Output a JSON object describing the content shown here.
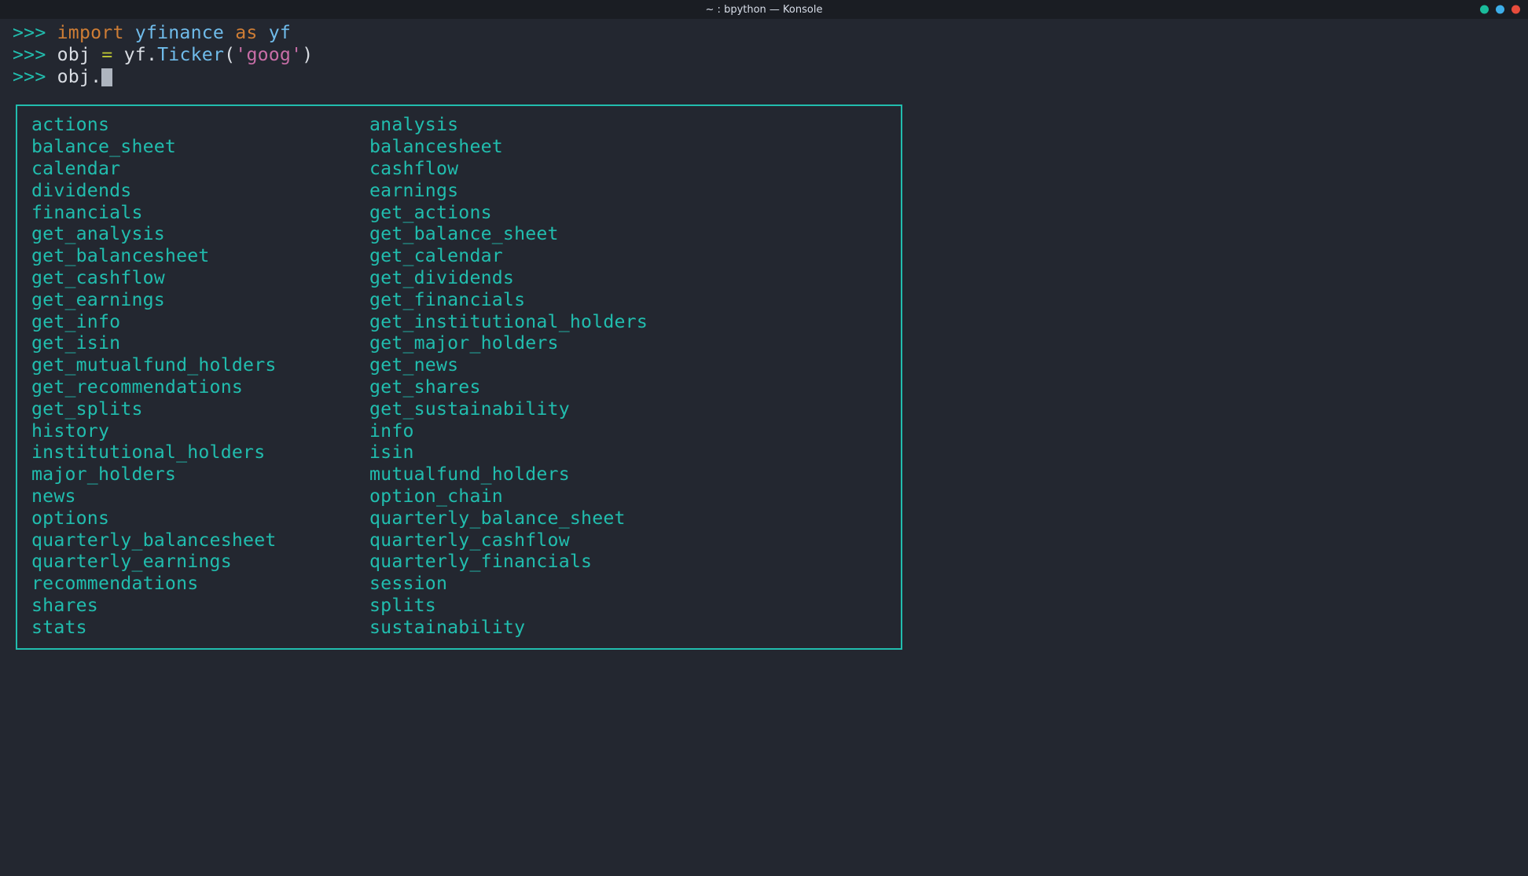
{
  "window": {
    "title": "~ : bpython — Konsole"
  },
  "terminal": {
    "lines": [
      {
        "prompt": ">>> ",
        "tokens": [
          {
            "cls": "kw-import",
            "text": "import"
          },
          {
            "cls": "",
            "text": " "
          },
          {
            "cls": "mod",
            "text": "yfinance"
          },
          {
            "cls": "",
            "text": " "
          },
          {
            "cls": "kw-as",
            "text": "as"
          },
          {
            "cls": "",
            "text": " "
          },
          {
            "cls": "mod",
            "text": "yf"
          }
        ]
      },
      {
        "prompt": ">>> ",
        "tokens": [
          {
            "cls": "ident",
            "text": "obj"
          },
          {
            "cls": "",
            "text": " "
          },
          {
            "cls": "eq",
            "text": "="
          },
          {
            "cls": "",
            "text": " "
          },
          {
            "cls": "ident",
            "text": "yf"
          },
          {
            "cls": "dot",
            "text": "."
          },
          {
            "cls": "attr",
            "text": "Ticker"
          },
          {
            "cls": "paren",
            "text": "("
          },
          {
            "cls": "string",
            "text": "'goog'"
          },
          {
            "cls": "paren",
            "text": ")"
          }
        ]
      },
      {
        "prompt": ">>> ",
        "tokens": [
          {
            "cls": "ident",
            "text": "obj"
          },
          {
            "cls": "dot",
            "text": "."
          }
        ],
        "cursor": true
      }
    ]
  },
  "completions": {
    "rows": [
      [
        "actions",
        "analysis"
      ],
      [
        "balance_sheet",
        "balancesheet"
      ],
      [
        "calendar",
        "cashflow"
      ],
      [
        "dividends",
        "earnings"
      ],
      [
        "financials",
        "get_actions"
      ],
      [
        "get_analysis",
        "get_balance_sheet"
      ],
      [
        "get_balancesheet",
        "get_calendar"
      ],
      [
        "get_cashflow",
        "get_dividends"
      ],
      [
        "get_earnings",
        "get_financials"
      ],
      [
        "get_info",
        "get_institutional_holders"
      ],
      [
        "get_isin",
        "get_major_holders"
      ],
      [
        "get_mutualfund_holders",
        "get_news"
      ],
      [
        "get_recommendations",
        "get_shares"
      ],
      [
        "get_splits",
        "get_sustainability"
      ],
      [
        "history",
        "info"
      ],
      [
        "institutional_holders",
        "isin"
      ],
      [
        "major_holders",
        "mutualfund_holders"
      ],
      [
        "news",
        "option_chain"
      ],
      [
        "options",
        "quarterly_balance_sheet"
      ],
      [
        "quarterly_balancesheet",
        "quarterly_cashflow"
      ],
      [
        "quarterly_earnings",
        "quarterly_financials"
      ],
      [
        "recommendations",
        "session"
      ],
      [
        "shares",
        "splits"
      ],
      [
        "stats",
        "sustainability"
      ]
    ]
  }
}
